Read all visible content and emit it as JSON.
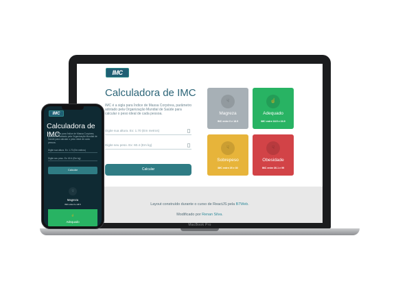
{
  "logo": "IMC",
  "title": "Calculadora de IMC",
  "description": "IMC é a sigla para Índice de Massa Corpórea, parâmetro adotado pela Organização Mundial de Saúde para calcular o peso ideal de cada pessoa.",
  "inputs": {
    "height_placeholder": "Digite sua altura. Ex: 1.70 (Em metros)",
    "weight_placeholder": "Digite seu peso. Ex: 60.4 (Em kg)"
  },
  "button_label": "Calcular",
  "cards": [
    {
      "name": "Magreza",
      "range": "IMC entre 0 e 18.5",
      "color": "#a7b0b6",
      "icon": "thumb-down-icon"
    },
    {
      "name": "Adequado",
      "range": "IMC entre 18.5 e 24.9",
      "color": "#28b363",
      "icon": "thumb-up-icon"
    },
    {
      "name": "Sobrepeso",
      "range": "IMC entre 25 e 30",
      "color": "#e7b43a",
      "icon": "thumb-down-icon"
    },
    {
      "name": "Obesidade",
      "range": "IMC entre 30.1 e 99",
      "color": "#d24347",
      "icon": "thumb-down-icon"
    }
  ],
  "footer": {
    "line1_prefix": "Layout construído durante o curso de ReactJS pela ",
    "line1_link": "B7Web",
    "line1_suffix": ".",
    "line2_prefix": "Modificado por ",
    "line2_link": "Renan Silva",
    "line2_suffix": "."
  },
  "device_brand": "MacBook Pro"
}
